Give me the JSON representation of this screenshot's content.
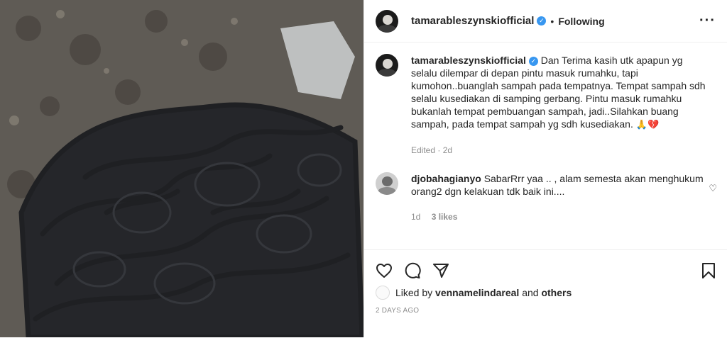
{
  "post": {
    "image_description_icon": "photo"
  },
  "header": {
    "username": "tamarableszynskiofficial",
    "dot": "•",
    "follow_label": "Following",
    "more_label": "···"
  },
  "caption": {
    "username": "tamarableszynskiofficial",
    "text": "Dan Terima kasih utk apapun yg selalu dilempar di depan pintu masuk rumahku, tapi kumohon..buanglah sampah pada tempatnya. Tempat sampah sdh selalu kusediakan di samping gerbang. Pintu masuk rumahku bukanlah tempat pembuangan sampah, jadi..Silahkan buang sampah, pada tempat sampah yg sdh kusediakan.",
    "emojis": "🙏💔",
    "edited": "Edited · 2d"
  },
  "comment": {
    "username": "djobahagianyo",
    "text": "SabarRrr yaa .. , alam semesta akan menghukum orang2 dgn kelakuan tdk baik ini....",
    "age": "1d",
    "likes": "3 likes"
  },
  "likes": {
    "prefix": "Liked by",
    "user": "vennamelindareal",
    "and": "and",
    "others": "others"
  },
  "timestamp": "2 DAYS AGO"
}
